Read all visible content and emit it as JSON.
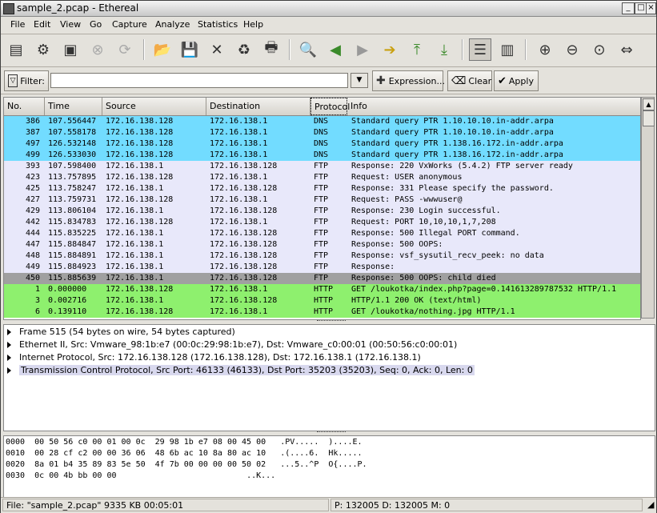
{
  "window": {
    "title": "sample_2.pcap - Ethereal"
  },
  "menu": [
    "File",
    "Edit",
    "View",
    "Go",
    "Capture",
    "Analyze",
    "Statistics",
    "Help"
  ],
  "filter": {
    "label": "Filter:",
    "value": "",
    "expression_label": "Expression...",
    "clear_label": "Clear",
    "apply_label": "Apply"
  },
  "packet_list": {
    "columns": [
      "No.",
      "Time",
      "Source",
      "Destination",
      "Protocol",
      "Info"
    ],
    "rows": [
      {
        "no": "386",
        "time": "107.556447",
        "src": "172.16.138.128",
        "dst": "172.16.138.1",
        "proto": "DNS",
        "info": "Standard query PTR 1.10.10.10.in-addr.arpa",
        "color": "#72dcff"
      },
      {
        "no": "387",
        "time": "107.558178",
        "src": "172.16.138.128",
        "dst": "172.16.138.1",
        "proto": "DNS",
        "info": "Standard query PTR 1.10.10.10.in-addr.arpa",
        "color": "#72dcff"
      },
      {
        "no": "497",
        "time": "126.532148",
        "src": "172.16.138.128",
        "dst": "172.16.138.1",
        "proto": "DNS",
        "info": "Standard query PTR 1.138.16.172.in-addr.arpa",
        "color": "#72dcff"
      },
      {
        "no": "499",
        "time": "126.533030",
        "src": "172.16.138.128",
        "dst": "172.16.138.1",
        "proto": "DNS",
        "info": "Standard query PTR 1.138.16.172.in-addr.arpa",
        "color": "#72dcff"
      },
      {
        "no": "393",
        "time": "107.598400",
        "src": "172.16.138.1",
        "dst": "172.16.138.128",
        "proto": "FTP",
        "info": "Response: 220 VxWorks (5.4.2) FTP server ready",
        "color": "#e8e8fa"
      },
      {
        "no": "423",
        "time": "113.757895",
        "src": "172.16.138.128",
        "dst": "172.16.138.1",
        "proto": "FTP",
        "info": "Request: USER anonymous",
        "color": "#e8e8fa"
      },
      {
        "no": "425",
        "time": "113.758247",
        "src": "172.16.138.1",
        "dst": "172.16.138.128",
        "proto": "FTP",
        "info": "Response: 331 Please specify the password.",
        "color": "#e8e8fa"
      },
      {
        "no": "427",
        "time": "113.759731",
        "src": "172.16.138.128",
        "dst": "172.16.138.1",
        "proto": "FTP",
        "info": "Request: PASS -wwwuser@",
        "color": "#e8e8fa"
      },
      {
        "no": "429",
        "time": "113.806104",
        "src": "172.16.138.1",
        "dst": "172.16.138.128",
        "proto": "FTP",
        "info": "Response: 230 Login successful.",
        "color": "#e8e8fa"
      },
      {
        "no": "442",
        "time": "115.834783",
        "src": "172.16.138.128",
        "dst": "172.16.138.1",
        "proto": "FTP",
        "info": "Request: PORT 10,10,10,1,7,208",
        "color": "#e8e8fa"
      },
      {
        "no": "444",
        "time": "115.835225",
        "src": "172.16.138.1",
        "dst": "172.16.138.128",
        "proto": "FTP",
        "info": "Response: 500 Illegal PORT command.",
        "color": "#e8e8fa"
      },
      {
        "no": "447",
        "time": "115.884847",
        "src": "172.16.138.1",
        "dst": "172.16.138.128",
        "proto": "FTP",
        "info": "Response: 500 OOPS:",
        "color": "#e8e8fa"
      },
      {
        "no": "448",
        "time": "115.884891",
        "src": "172.16.138.1",
        "dst": "172.16.138.128",
        "proto": "FTP",
        "info": "Response: vsf_sysutil_recv_peek: no data",
        "color": "#e8e8fa"
      },
      {
        "no": "449",
        "time": "115.884923",
        "src": "172.16.138.1",
        "dst": "172.16.138.128",
        "proto": "FTP",
        "info": "Response:",
        "color": "#e8e8fa"
      },
      {
        "no": "450",
        "time": "115.885639",
        "src": "172.16.138.1",
        "dst": "172.16.138.128",
        "proto": "FTP",
        "info": "Response: 500 OOPS: child died",
        "color": "#a0a0a0"
      },
      {
        "no": "1",
        "time": "0.000000",
        "src": "172.16.138.128",
        "dst": "172.16.138.1",
        "proto": "HTTP",
        "info": "GET /loukotka/index.php?page=0.141613289787532 HTTP/1.1",
        "color": "#8ef06e"
      },
      {
        "no": "3",
        "time": "0.002716",
        "src": "172.16.138.1",
        "dst": "172.16.138.128",
        "proto": "HTTP",
        "info": "HTTP/1.1 200 OK (text/html)",
        "color": "#8ef06e"
      },
      {
        "no": "6",
        "time": "0.139110",
        "src": "172.16.138.128",
        "dst": "172.16.138.1",
        "proto": "HTTP",
        "info": "GET /loukotka/nothing.jpg HTTP/1.1",
        "color": "#8ef06e"
      }
    ]
  },
  "details": [
    "Frame 515 (54 bytes on wire, 54 bytes captured)",
    "Ethernet II, Src: Vmware_98:1b:e7 (00:0c:29:98:1b:e7), Dst: Vmware_c0:00:01 (00:50:56:c0:00:01)",
    "Internet Protocol, Src: 172.16.138.128 (172.16.138.128), Dst: 172.16.138.1 (172.16.138.1)",
    "Transmission Control Protocol, Src Port: 46133 (46133), Dst Port: 35203 (35203), Seq: 0, Ack: 0, Len: 0"
  ],
  "bytes": [
    {
      "offset": "0000",
      "hex": "00 50 56 c0 00 01 00 0c  29 98 1b e7 08 00 45 00",
      "ascii": ".PV.....  )....E."
    },
    {
      "offset": "0010",
      "hex": "00 28 cf c2 00 00 36 06  48 6b ac 10 8a 80 ac 10",
      "ascii": ".(....6.  Hk....."
    },
    {
      "offset": "0020",
      "hex": "8a 01 b4 35 89 83 5e 50  4f 7b 00 00 00 00 50 02",
      "ascii": "...5..^P  O{....P."
    },
    {
      "offset": "0030",
      "hex": "0c 00 4b bb 00 00",
      "ascii": "..K..."
    }
  ],
  "status": {
    "file": "File: \"sample_2.pcap\" 9335 KB 00:05:01",
    "packets": "P: 132005 D: 132005 M: 0"
  }
}
